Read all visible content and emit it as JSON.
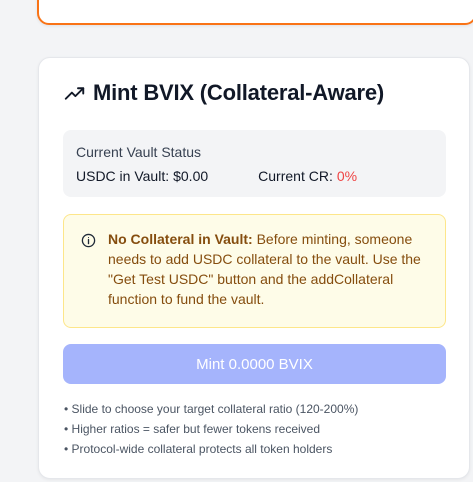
{
  "mint_card": {
    "title": "Mint BVIX (Collateral-Aware)",
    "icon": "trending-up-icon",
    "vault_status": {
      "title": "Current Vault Status",
      "usdc_label": "USDC in Vault:",
      "usdc_value": "$0.00",
      "cr_label": "Current CR:",
      "cr_value": "0%"
    },
    "warning": {
      "icon": "info-icon",
      "heading": "No Collateral in Vault:",
      "body": "Before minting, someone needs to add USDC collateral to the vault. Use the \"Get Test USDC\" button and the addCollateral function to fund the vault."
    },
    "mint_button_label": "Mint 0.0000 BVIX",
    "notes": [
      "Slide to choose your target collateral ratio (120-200%)",
      "Higher ratios = safer but fewer tokens received",
      "Protocol-wide collateral protects all token holders"
    ]
  },
  "colors": {
    "accent_orange": "#f97316",
    "button_disabled": "#a5b4fc",
    "warning_bg": "#fefce8",
    "warning_border": "#fde68a",
    "warning_text": "#854d0e",
    "cr_red": "#ef4444"
  }
}
